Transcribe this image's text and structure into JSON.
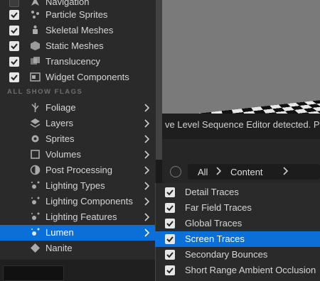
{
  "menu": {
    "top_items": [
      {
        "label": "Navigation",
        "checked": false,
        "icon": "navigation-icon"
      },
      {
        "label": "Particle Sprites",
        "checked": true,
        "icon": "particle-sprites-icon"
      },
      {
        "label": "Skeletal Meshes",
        "checked": true,
        "icon": "skeletal-mesh-icon"
      },
      {
        "label": "Static Meshes",
        "checked": true,
        "icon": "static-mesh-icon"
      },
      {
        "label": "Translucency",
        "checked": true,
        "icon": "translucency-icon"
      },
      {
        "label": "Widget Components",
        "checked": true,
        "icon": "widget-components-icon"
      }
    ],
    "section_header": "ALL SHOW FLAGS",
    "flag_items": [
      {
        "label": "Foliage",
        "icon": "foliage-icon"
      },
      {
        "label": "Layers",
        "icon": "layers-icon"
      },
      {
        "label": "Sprites",
        "icon": "sprites-icon"
      },
      {
        "label": "Volumes",
        "icon": "volumes-icon"
      },
      {
        "label": "Post Processing",
        "icon": "post-processing-icon"
      },
      {
        "label": "Lighting Types",
        "icon": "lighting-types-icon"
      },
      {
        "label": "Lighting Components",
        "icon": "lighting-components-icon"
      },
      {
        "label": "Lighting Features",
        "icon": "lighting-features-icon"
      },
      {
        "label": "Lumen",
        "icon": "lumen-icon",
        "selected": true
      },
      {
        "label": "Nanite",
        "icon": "nanite-icon"
      }
    ]
  },
  "viewport": {
    "notice": "ve Level Sequence Editor detected. Plea"
  },
  "content_browser": {
    "breadcrumb": [
      "All",
      "Content"
    ]
  },
  "submenu": {
    "items": [
      {
        "label": "Detail Traces",
        "checked": true
      },
      {
        "label": "Far Field Traces",
        "checked": true
      },
      {
        "label": "Global Traces",
        "checked": true
      },
      {
        "label": "Screen Traces",
        "checked": true,
        "selected": true
      },
      {
        "label": "Secondary Bounces",
        "checked": true
      },
      {
        "label": "Short Range Ambient Occlusion",
        "checked": true
      }
    ]
  },
  "colors": {
    "accent": "#0a6fd6",
    "panel": "#2a2a2a"
  }
}
